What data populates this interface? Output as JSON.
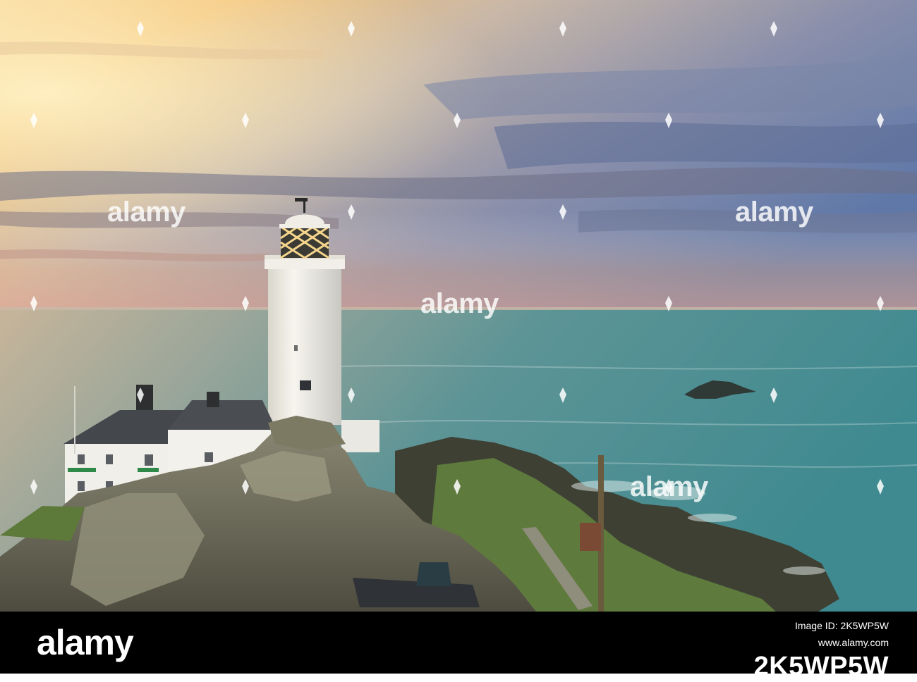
{
  "image": {
    "subject": "White lighthouse with adjoining cottages on a rocky headland above a calm sea at sunset",
    "palette": {
      "sky_warm": "#f6c46a",
      "sky_cool": "#6f7fa6",
      "sea": "#4f8f92",
      "rock": "#6f6c5a",
      "grass": "#5f7a3d",
      "lighthouse": "#f3f2ec"
    }
  },
  "watermark": {
    "text": "alamy"
  },
  "footer": {
    "logo": "alamy",
    "caption": "Image ID: 2K5WP5W",
    "site": "www.alamy.com",
    "image_id": "2K5WP5W"
  }
}
